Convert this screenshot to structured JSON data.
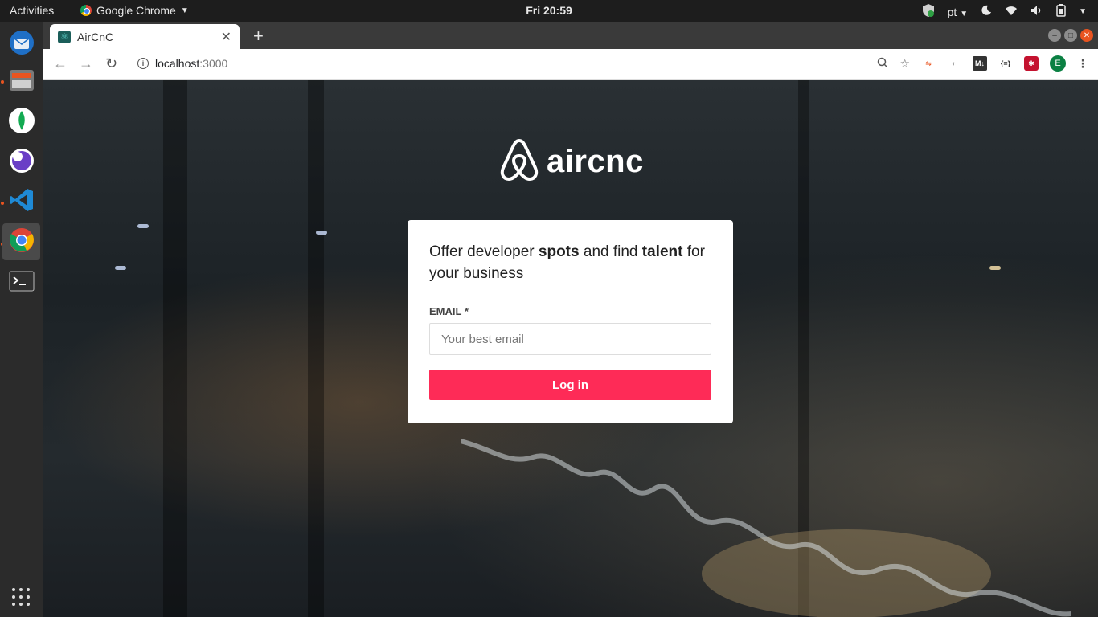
{
  "system": {
    "activities": "Activities",
    "app_name": "Google Chrome",
    "clock": "Fri 20:59",
    "language": "pt"
  },
  "browser": {
    "tab_title": "AirCnC",
    "url_host": "localhost",
    "url_port": ":3000",
    "avatar_initial": "E"
  },
  "page": {
    "logo_text": "aircnc",
    "headline_part1": "Offer developer ",
    "headline_bold1": "spots",
    "headline_part2": " and find ",
    "headline_bold2": "talent",
    "headline_part3": " for your business",
    "email_label": "EMAIL *",
    "email_placeholder": "Your best email",
    "email_value": "",
    "login_label": "Log in"
  },
  "colors": {
    "accent": "#fe2b57",
    "dock": "#2b2b2b",
    "topbar": "#1d1d1d"
  },
  "icons": {
    "dock": [
      "thunderbird-icon",
      "files-icon",
      "mongodb-compass-icon",
      "insomnia-icon",
      "vscode-icon",
      "chrome-icon",
      "terminal-icon"
    ]
  }
}
